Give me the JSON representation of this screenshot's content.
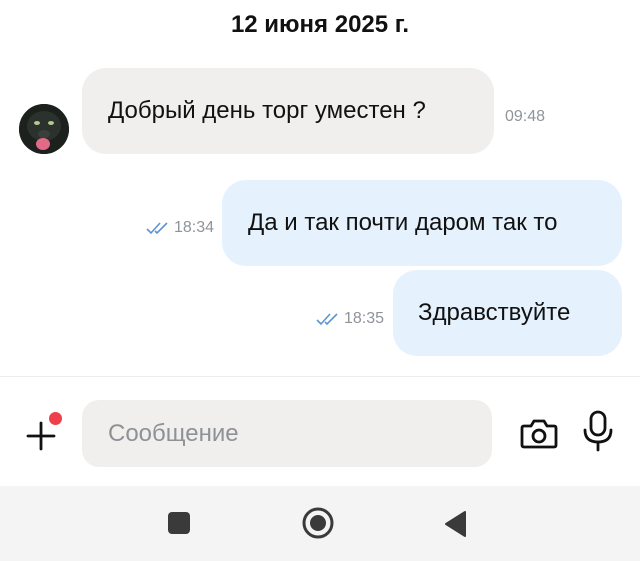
{
  "chat": {
    "date_header": "12 июня 2025 г.",
    "messages": [
      {
        "direction": "incoming",
        "text": "Добрый день торг уместен ?",
        "time": "09:48"
      },
      {
        "direction": "outgoing",
        "text": "Да и так почти даром так то",
        "time": "18:34",
        "status": "read"
      },
      {
        "direction": "outgoing",
        "text": "Здравствуйте",
        "time": "18:35",
        "status": "read"
      }
    ]
  },
  "composer": {
    "placeholder": "Сообщение",
    "attach_icon": "plus-icon",
    "camera_icon": "camera-icon",
    "mic_icon": "microphone-icon",
    "notification_dot_color": "#ef3f4b"
  },
  "nav": {
    "buttons": [
      "recent-apps",
      "home",
      "back"
    ]
  },
  "colors": {
    "incoming_bubble": "#f0efee",
    "outgoing_bubble": "#e5f2fd",
    "read_check": "#5b95d6",
    "time_text": "#8f949a"
  }
}
